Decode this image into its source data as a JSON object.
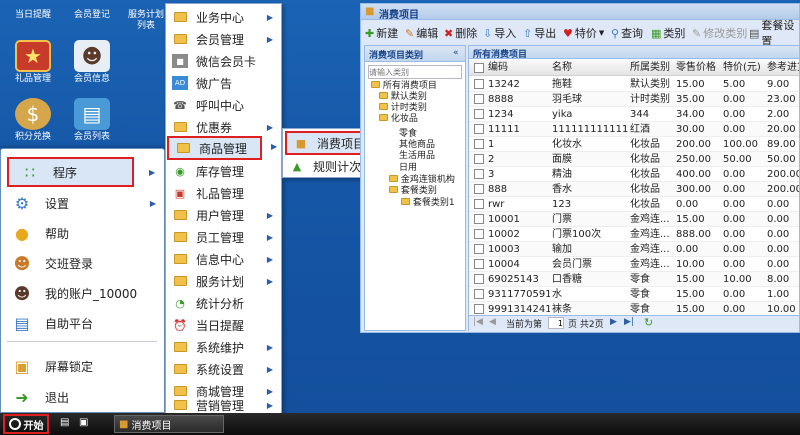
{
  "desktop_icons": [
    {
      "label": "当日提醒",
      "icon": "alarm-icon"
    },
    {
      "label": "会员登记",
      "icon": "user-register-icon"
    },
    {
      "label": "服务计划\n列表",
      "icon": "service-plan-icon"
    },
    {
      "label": "礼品管理",
      "icon": "gift-icon"
    },
    {
      "label": "会员信息",
      "icon": "member-info-icon"
    },
    {
      "label": "积分兑换",
      "icon": "points-exchange-icon"
    },
    {
      "label": "会员列表",
      "icon": "member-list-icon"
    }
  ],
  "start_menu": {
    "items": [
      "程序",
      "设置",
      "帮助",
      "交班登录",
      "我的账户_10000",
      "自助平台",
      "屏幕锁定",
      "退出"
    ]
  },
  "program_menu": {
    "items": [
      "业务中心",
      "会员管理",
      "微信会员卡",
      "微广告",
      "呼叫中心",
      "优惠券",
      "商品管理",
      "库存管理",
      "礼品管理",
      "用户管理",
      "员工管理",
      "信息中心",
      "服务计划",
      "统计分析",
      "当日提醒",
      "系统维护",
      "系统设置",
      "商城管理",
      "营销管理"
    ]
  },
  "goods_menu": {
    "items": [
      "消费项目",
      "规则计次设置"
    ]
  },
  "window": {
    "title": "消费项目",
    "toolbar": [
      "新建",
      "编辑",
      "删除",
      "导入",
      "导出",
      "特价",
      "查询",
      "类别",
      "修改类别",
      "套餐设置"
    ],
    "left_panel": {
      "title": "消费项目类别",
      "search_placeholder": "请输入类别",
      "tree": [
        "所有消费项目",
        "默认类别",
        "计时类别",
        "化妆品",
        "零食",
        "其他商品",
        "生活用品",
        "日用",
        "金鸡连锁机构",
        "套餐类别",
        "套餐类别1"
      ]
    },
    "grid": {
      "title": "所有消费项目",
      "columns": [
        "编码",
        "名称",
        "所属类别",
        "零售价格",
        "特价(元)",
        "参考进货"
      ],
      "rows": [
        [
          "13242",
          "拖鞋",
          "默认类别",
          "15.00",
          "5.00",
          "9.00"
        ],
        [
          "8888",
          "羽毛球",
          "计时类别",
          "35.00",
          "0.00",
          "23.00"
        ],
        [
          "1234",
          "yika",
          "344",
          "34.00",
          "0.00",
          "2.00"
        ],
        [
          "11111",
          "1111111111111",
          "红酒",
          "30.00",
          "0.00",
          "20.00"
        ],
        [
          "1",
          "化妆水",
          "化妆品",
          "200.00",
          "100.00",
          "89.00"
        ],
        [
          "2",
          "面膜",
          "化妆品",
          "250.00",
          "50.00",
          "50.00"
        ],
        [
          "3",
          "精油",
          "化妆品",
          "400.00",
          "0.00",
          "200.00"
        ],
        [
          "888",
          "香水",
          "化妆品",
          "300.00",
          "0.00",
          "200.00"
        ],
        [
          "rwr",
          "123",
          "化妆品",
          "0.00",
          "0.00",
          "0.00"
        ],
        [
          "10001",
          "门票",
          "金鸡连...",
          "15.00",
          "0.00",
          "0.00"
        ],
        [
          "10002",
          "门票100次",
          "金鸡连...",
          "888.00",
          "0.00",
          "0.00"
        ],
        [
          "10003",
          "输加",
          "金鸡连...",
          "0.00",
          "0.00",
          "0.00"
        ],
        [
          "10004",
          "会员门票",
          "金鸡连...",
          "10.00",
          "0.00",
          "0.00"
        ],
        [
          "69025143",
          "口香糖",
          "零食",
          "15.00",
          "10.00",
          "8.00"
        ],
        [
          "9311770591...",
          "水",
          "零食",
          "15.00",
          "0.00",
          "1.00"
        ],
        [
          "9991314241...",
          "袜条",
          "零食",
          "15.00",
          "0.00",
          "10.00"
        ]
      ]
    },
    "pager": {
      "current_label": "当前为第",
      "page": "1",
      "total_label": "页 共2页"
    }
  },
  "taskbar": {
    "start_label": "开始",
    "task_label": "消费项目"
  }
}
